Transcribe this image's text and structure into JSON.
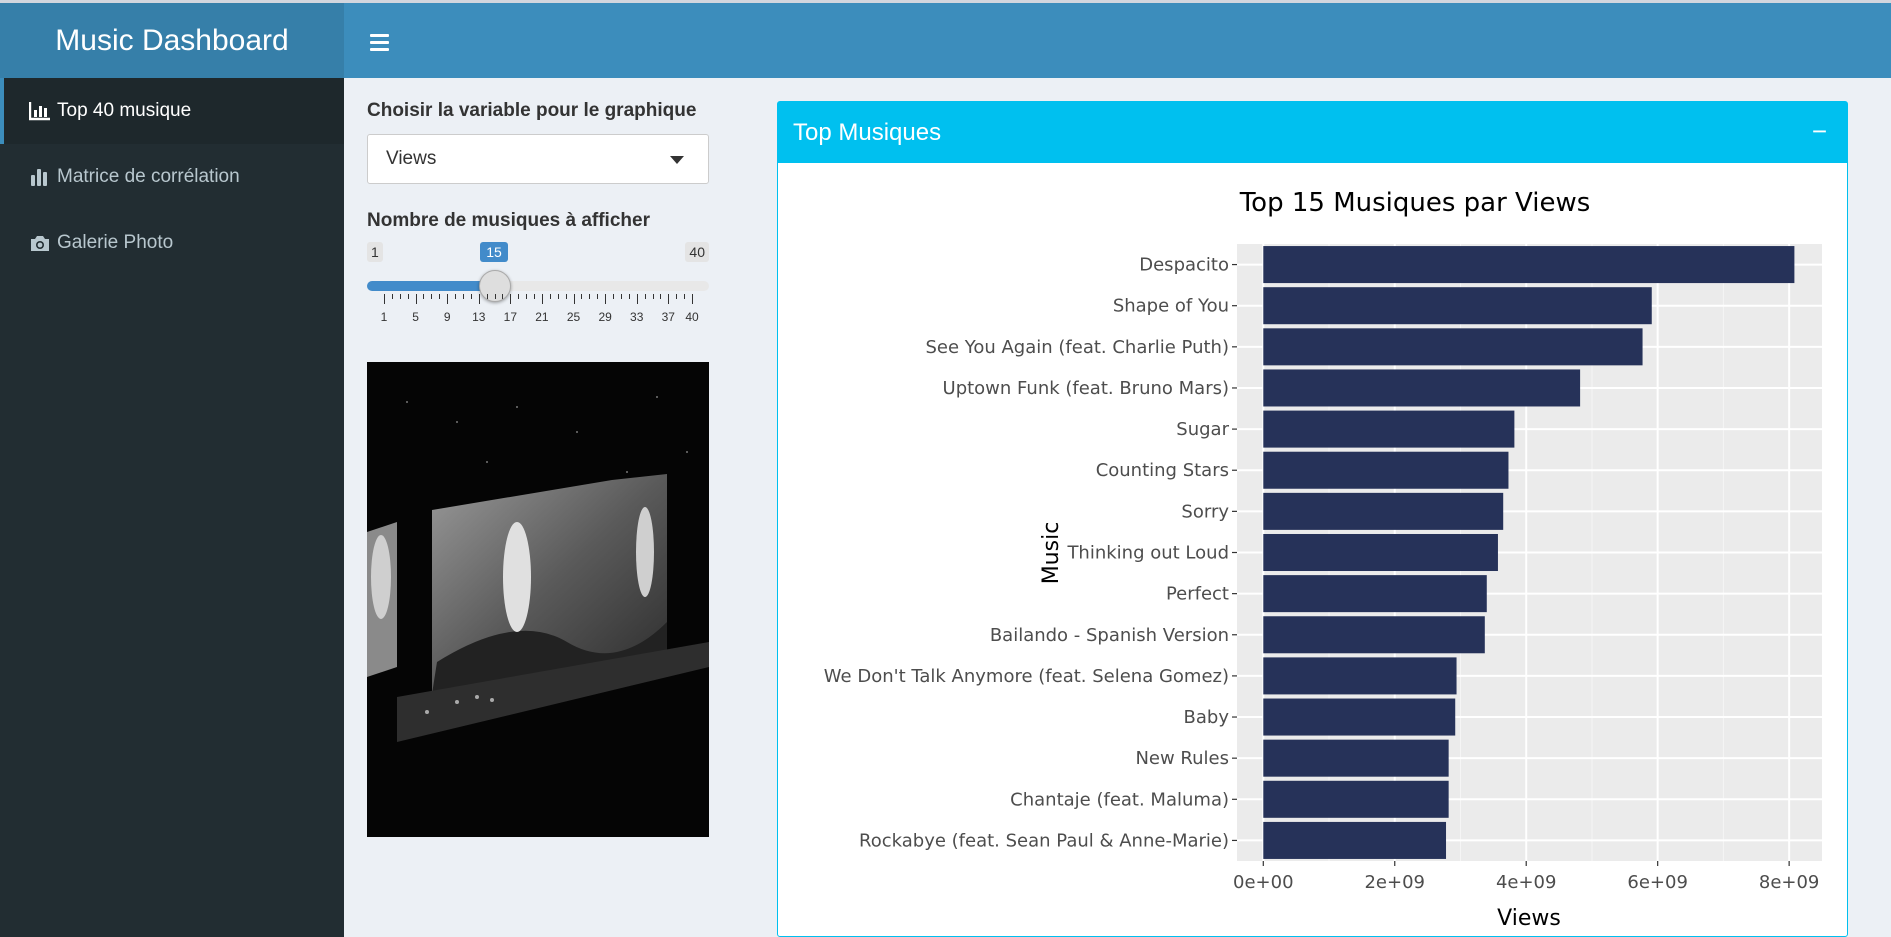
{
  "header": {
    "brand": "Music Dashboard",
    "menu_icon": "hamburger-icon"
  },
  "sidebar": {
    "items": [
      {
        "label": "Top 40 musique",
        "icon": "bar-chart-icon",
        "active": true
      },
      {
        "label": "Matrice de corrélation",
        "icon": "stats-icon",
        "active": false
      },
      {
        "label": "Galerie Photo",
        "icon": "camera-icon",
        "active": false
      }
    ]
  },
  "controls": {
    "variable_label": "Choisir la variable pour le graphique",
    "variable_value": "Views",
    "count_label": "Nombre de musiques à afficher",
    "slider": {
      "min": "1",
      "max": "40",
      "value": "15",
      "tick_labels": [
        "1",
        "5",
        "9",
        "13",
        "17",
        "21",
        "25",
        "29",
        "33",
        "37",
        "40"
      ]
    }
  },
  "box": {
    "title": "Top Musiques",
    "collapse_label": "−"
  },
  "colors": {
    "header": "#3c8dbc",
    "brand": "#367fa9",
    "sidebar": "#222d32",
    "box_accent": "#00c0ef",
    "bar": "#263259"
  },
  "chart_data": {
    "type": "bar",
    "orientation": "horizontal",
    "title": "Top 15 Musiques par Views",
    "xlabel": "Views",
    "ylabel": "Music",
    "categories": [
      "Despacito",
      "Shape of You",
      "See You Again (feat. Charlie Puth)",
      "Uptown Funk (feat. Bruno Mars)",
      "Sugar",
      "Counting Stars",
      "Sorry",
      "Thinking out Loud",
      "Perfect",
      "Bailando - Spanish Version",
      "We Don't Talk Anymore (feat. Selena Gomez)",
      "Baby",
      "New Rules",
      "Chantaje (feat. Maluma)",
      "Rockabye (feat. Sean Paul & Anne-Marie)"
    ],
    "values": [
      8080000000,
      5910000000,
      5770000000,
      4820000000,
      3820000000,
      3730000000,
      3650000000,
      3570000000,
      3400000000,
      3370000000,
      2940000000,
      2920000000,
      2820000000,
      2820000000,
      2780000000
    ],
    "xlim": [
      -400000000,
      8500000000
    ],
    "xticks": [
      0,
      2000000000,
      4000000000,
      6000000000,
      8000000000
    ],
    "xtick_labels": [
      "0e+00",
      "2e+09",
      "4e+09",
      "6e+09",
      "8e+09"
    ],
    "grid": true
  }
}
